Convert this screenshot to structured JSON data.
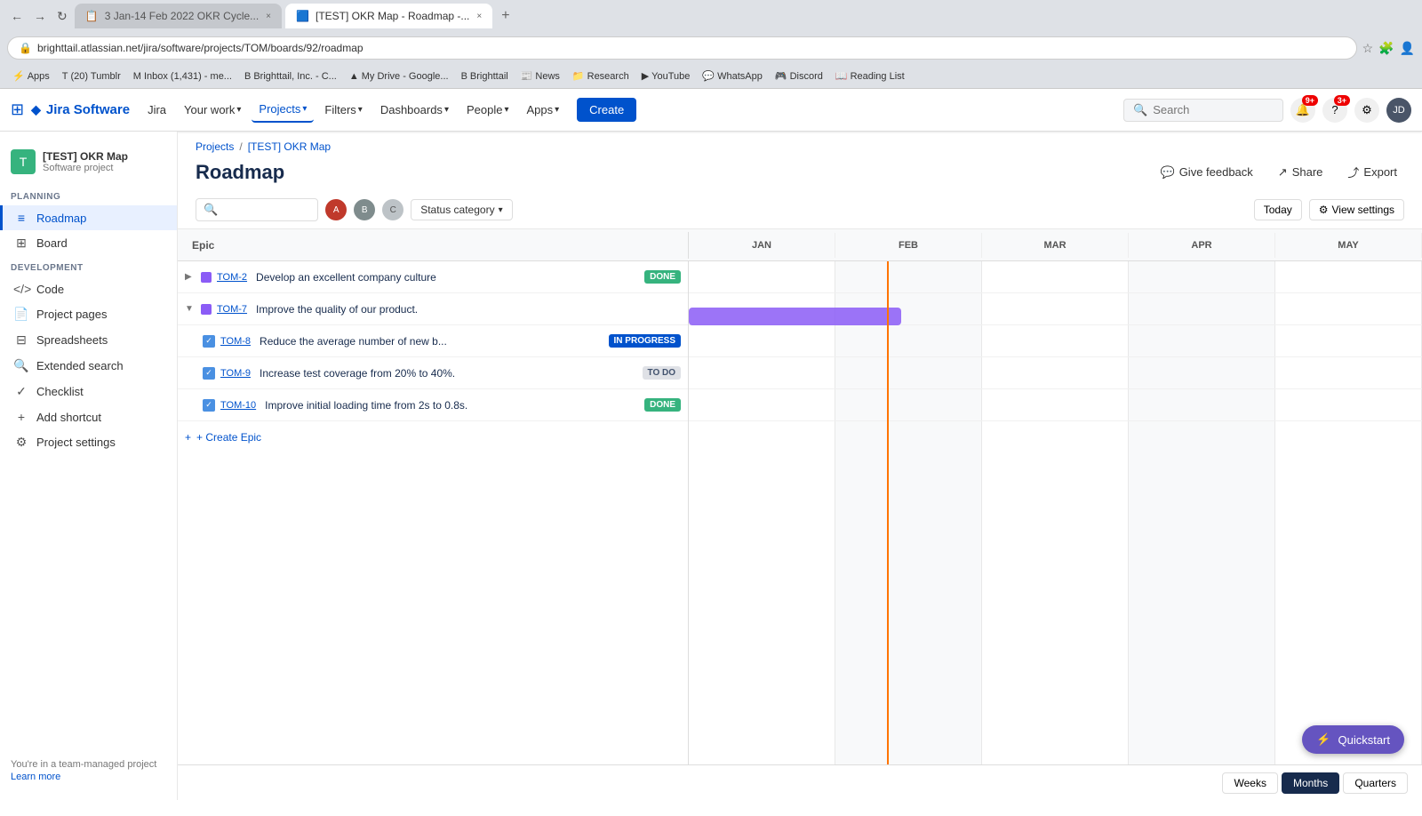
{
  "browser": {
    "tabs": [
      {
        "id": "tab1",
        "title": "3 Jan-14 Feb 2022 OKR Cycle...",
        "active": false,
        "favicon": "📋"
      },
      {
        "id": "tab2",
        "title": "[TEST] OKR Map - Roadmap -...",
        "active": true,
        "favicon": "🟦"
      }
    ],
    "address": "brighttail.atlassian.net/jira/software/projects/TOM/boards/92/roadmap",
    "bookmarks": [
      {
        "label": "Apps",
        "icon": "⚡"
      },
      {
        "label": "(20) Tumblr",
        "icon": "T"
      },
      {
        "label": "Inbox (1,431) - me...",
        "icon": "M"
      },
      {
        "label": "Brighttail, Inc. - C...",
        "icon": "B"
      },
      {
        "label": "My Drive - Google...",
        "icon": "▲"
      },
      {
        "label": "Brighttail",
        "icon": "B"
      },
      {
        "label": "News",
        "icon": "📰"
      },
      {
        "label": "Research",
        "icon": "📁"
      },
      {
        "label": "YouTube",
        "icon": "▶"
      },
      {
        "label": "WhatsApp",
        "icon": "💬"
      },
      {
        "label": "Discord",
        "icon": "🎮"
      },
      {
        "label": "Reading List",
        "icon": "📖"
      }
    ]
  },
  "nav": {
    "logo_text": "Jira Software",
    "jira_label": "Jira",
    "links": [
      {
        "label": "Your work",
        "dropdown": true
      },
      {
        "label": "Projects",
        "dropdown": true,
        "active": true
      },
      {
        "label": "Filters",
        "dropdown": true
      },
      {
        "label": "Dashboards",
        "dropdown": true
      },
      {
        "label": "People",
        "dropdown": true
      },
      {
        "label": "Apps",
        "dropdown": true
      }
    ],
    "create_label": "Create",
    "search_placeholder": "Search",
    "notification_badge1": "9+",
    "notification_badge2": "3+"
  },
  "sidebar": {
    "project_name": "[TEST] OKR Map",
    "project_type": "Software project",
    "planning_label": "PLANNING",
    "development_label": "DEVELOPMENT",
    "items": [
      {
        "id": "roadmap",
        "label": "Roadmap",
        "icon": "≡",
        "active": true,
        "section": "planning"
      },
      {
        "id": "board",
        "label": "Board",
        "icon": "⊞",
        "active": false,
        "section": "planning"
      },
      {
        "id": "code",
        "label": "Code",
        "icon": "</>",
        "active": false,
        "section": "development"
      },
      {
        "id": "project-pages",
        "label": "Project pages",
        "icon": "📄",
        "active": false
      },
      {
        "id": "spreadsheets",
        "label": "Spreadsheets",
        "icon": "⊟",
        "active": false
      },
      {
        "id": "extended-search",
        "label": "Extended search",
        "icon": "🔍",
        "active": false
      },
      {
        "id": "checklist",
        "label": "Checklist",
        "icon": "✓",
        "active": false
      },
      {
        "id": "add-shortcut",
        "label": "Add shortcut",
        "icon": "+",
        "active": false
      },
      {
        "id": "project-settings",
        "label": "Project settings",
        "icon": "⚙",
        "active": false
      }
    ],
    "team_label": "You're in a team-managed project",
    "learn_more": "Learn more"
  },
  "breadcrumb": {
    "projects_link": "Projects",
    "separator": "/",
    "project_link": "[TEST] OKR Map"
  },
  "page": {
    "title": "Roadmap",
    "actions": [
      {
        "label": "Give feedback",
        "icon": "💬"
      },
      {
        "label": "Share",
        "icon": "↗"
      },
      {
        "label": "Export",
        "icon": "⤴"
      }
    ]
  },
  "toolbar": {
    "status_label": "Status category",
    "today_label": "Today",
    "view_settings_label": "View settings",
    "avatars": [
      {
        "color": "#c0392b",
        "initials": "A"
      },
      {
        "color": "#7f8c8d",
        "initials": "B"
      },
      {
        "color": "#bdc3c7",
        "initials": "C"
      }
    ]
  },
  "timeline": {
    "columns": [
      "JAN",
      "FEB",
      "MAR",
      "APR",
      "MAY"
    ],
    "today_position_pct": 27
  },
  "epics": [
    {
      "id": "TOM-2",
      "name": "Develop an excellent company culture",
      "color": "#8b5cf6",
      "status": "DONE",
      "status_class": "status-done",
      "expanded": false,
      "indent": 0,
      "type": "epic",
      "bar": null,
      "children": []
    },
    {
      "id": "TOM-7",
      "name": "Improve the quality of our product.",
      "color": "#8b5cf6",
      "status": null,
      "expanded": true,
      "indent": 0,
      "type": "epic",
      "bar": {
        "left_pct": 0,
        "width_pct": 29,
        "color": "#8b5cf6"
      },
      "children": [
        {
          "id": "TOM-8",
          "name": "Reduce the average number of new b...",
          "status": "IN PROGRESS",
          "status_class": "status-inprogress",
          "indent": 1,
          "type": "task"
        },
        {
          "id": "TOM-9",
          "name": "Increase test coverage from 20% to 40%.",
          "status": "TO DO",
          "status_class": "status-todo",
          "indent": 1,
          "type": "task"
        },
        {
          "id": "TOM-10",
          "name": "Improve initial loading time from 2s to 0.8s.",
          "status": "DONE",
          "status_class": "status-done",
          "indent": 1,
          "type": "task"
        }
      ]
    }
  ],
  "create_epic_label": "+ Create Epic",
  "bottom": {
    "weeks_label": "Weeks",
    "months_label": "Months",
    "quarters_label": "Quarters"
  },
  "quickstart": {
    "label": "Quickstart",
    "icon": "⚡"
  }
}
